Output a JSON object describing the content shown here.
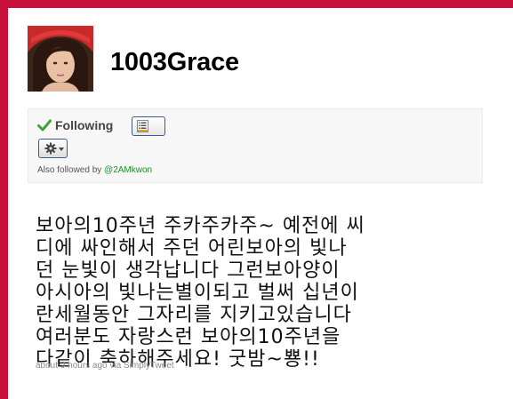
{
  "profile": {
    "username": "1003Grace",
    "avatar_icon": "user-avatar-photo"
  },
  "follow_box": {
    "status_label": "Following",
    "status_icon": "checkmark-icon",
    "list_button_icon": "list-icon",
    "actions_button_icon": "gear-icon",
    "also_followed_prefix": "Also followed by",
    "also_followed_user": "@2AMkwon"
  },
  "tweet": {
    "lines": [
      "보아의10주년 주카주카주~ 예전에 씨",
      "디에 싸인해서 주던 어린보아의 빛나",
      "던 눈빛이 생각납니다 그런보아양이",
      "아시아의 빛나는별이되고 벌써 십년이",
      "란세월동안 그자리를 지키고있습니다",
      "여러분도 자랑스런 보아의10주년을",
      "다같이 축하해주세요! 굿밤~뿅!!"
    ],
    "timestamp": "about 9 hours ago",
    "via_prefix": "via",
    "client": "SimplyTweet"
  },
  "colors": {
    "frame": "#c8103b",
    "following_check": "#3fa13a",
    "link_green": "#1c8f22"
  }
}
